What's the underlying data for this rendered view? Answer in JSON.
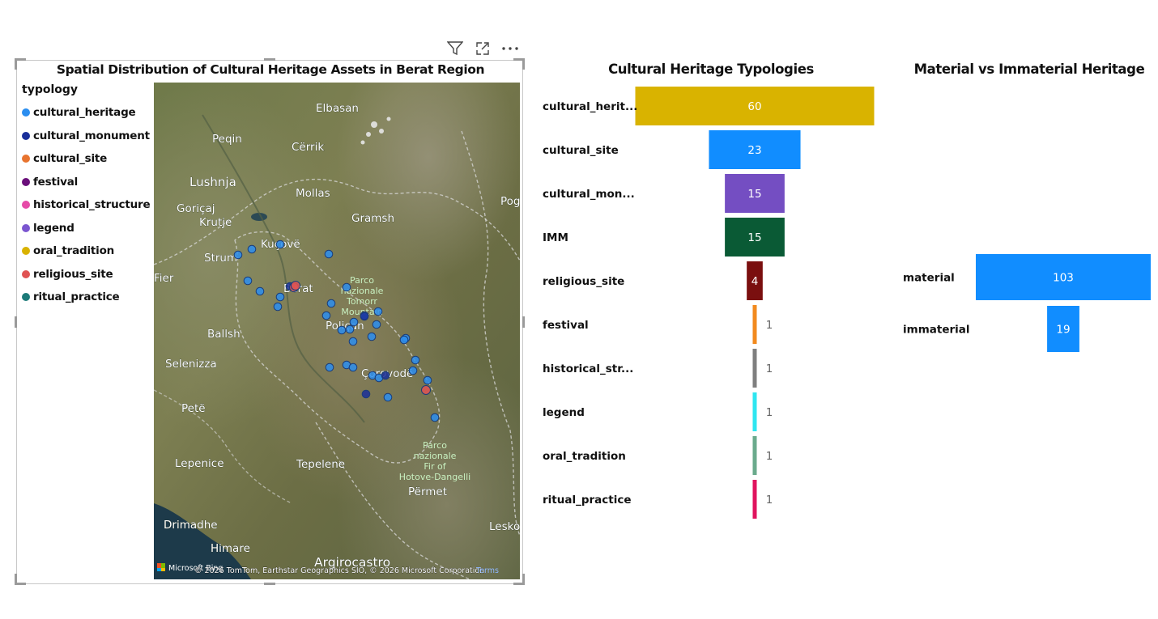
{
  "map_visual": {
    "title": "Spatial Distribution of Cultural Heritage Assets in Berat Region",
    "legend_title": "typology",
    "legend": [
      {
        "label": "cultural_heritage",
        "color": "#2b8ef0"
      },
      {
        "label": "cultural_monument",
        "color": "#1a2f9a"
      },
      {
        "label": "cultural_site",
        "color": "#e8742f"
      },
      {
        "label": "festival",
        "color": "#6a0f7a"
      },
      {
        "label": "historical_structure",
        "color": "#e64ba8"
      },
      {
        "label": "legend",
        "color": "#7b56d0"
      },
      {
        "label": "oral_tradition",
        "color": "#d9b200"
      },
      {
        "label": "religious_site",
        "color": "#e05353"
      },
      {
        "label": "ritual_practice",
        "color": "#1c7a78"
      }
    ],
    "place_labels": [
      {
        "text": "Elbasan"
      },
      {
        "text": "Peqin"
      },
      {
        "text": "Cërrik"
      },
      {
        "text": "Lushnja"
      },
      {
        "text": "Mollas"
      },
      {
        "text": "Pog"
      },
      {
        "text": "Goriçaj"
      },
      {
        "text": "Krutje"
      },
      {
        "text": "Gramsh"
      },
      {
        "text": "Kuçovë"
      },
      {
        "text": "Strum"
      },
      {
        "text": "Fier"
      },
      {
        "text": "Berat"
      },
      {
        "text": "Ballsh"
      },
      {
        "text": "Poliçan"
      },
      {
        "text": "Selenizza"
      },
      {
        "text": "Çorovodë"
      },
      {
        "text": "Petë"
      },
      {
        "text": "Lepenice"
      },
      {
        "text": "Tepelene"
      },
      {
        "text": "Përmet"
      },
      {
        "text": "Drimadhe"
      },
      {
        "text": "Leskov"
      },
      {
        "text": "Himare"
      },
      {
        "text": "Argirocastro"
      }
    ],
    "park_labels": [
      {
        "lines": [
          "Parco",
          "nazionale",
          "Tomorr",
          "Mountain"
        ]
      },
      {
        "lines": [
          "Parco",
          "nazionale",
          "Fir of",
          "Hotove-Dangelli"
        ]
      }
    ],
    "attribution": "© 2026 TomTom, Earthstar Geographics SIO, © 2026 Microsoft Corporation",
    "terms": "Terms",
    "brand": "Microsoft Bing"
  },
  "typology_chart": {
    "title": "Cultural Heritage Typologies",
    "chart_data": {
      "type": "bar",
      "categories": [
        "cultural_herit...",
        "cultural_site",
        "cultural_mon...",
        "IMM",
        "religious_site",
        "festival",
        "historical_str...",
        "legend",
        "oral_tradition",
        "ritual_practice"
      ],
      "values": [
        60,
        23,
        15,
        15,
        4,
        1,
        1,
        1,
        1,
        1
      ],
      "colors": [
        "#d9b300",
        "#118dff",
        "#744ec2",
        "#0a5a35",
        "#7a0f0f",
        "#f28a1e",
        "#7f7f7f",
        "#2ee6f0",
        "#6aaa8c",
        "#e0135e"
      ],
      "xlim": [
        0,
        60
      ]
    }
  },
  "material_chart": {
    "title": "Material vs Immaterial Heritage",
    "chart_data": {
      "type": "bar",
      "categories": [
        "material",
        "immaterial"
      ],
      "values": [
        103,
        19
      ],
      "colors": [
        "#118dff",
        "#118dff"
      ],
      "xlim": [
        0,
        103
      ]
    }
  }
}
